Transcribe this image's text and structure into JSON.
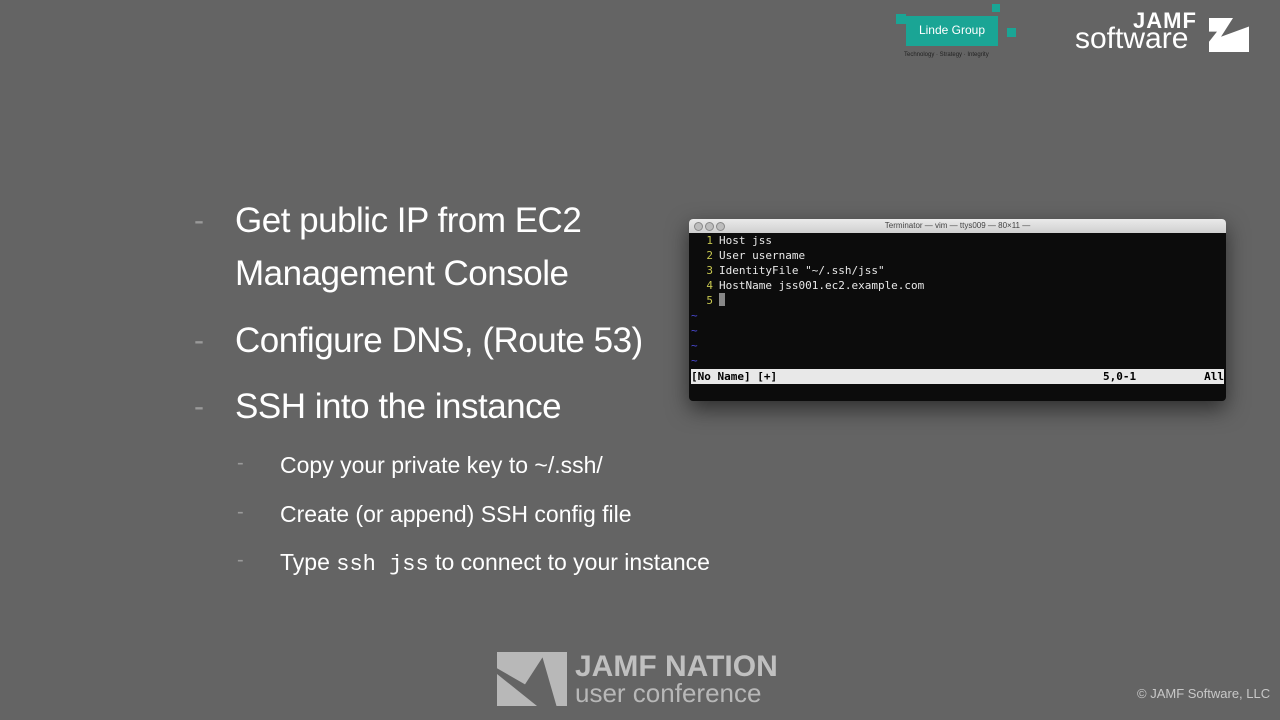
{
  "slide": {
    "bullets": [
      {
        "lines": [
          "Get public IP from EC2",
          "Management Console"
        ]
      },
      {
        "lines": [
          "Configure DNS, (Route 53)"
        ]
      },
      {
        "lines": [
          "SSH into the instance"
        ]
      }
    ],
    "sub_bullets": [
      {
        "text": "Copy your private key to ~/.ssh/"
      },
      {
        "text": "Create (or append) SSH config file"
      },
      {
        "before": "Type ",
        "code": "ssh jss",
        "after": " to connect to your instance"
      }
    ],
    "dash": "-"
  },
  "terminal": {
    "title": "Terminator — vim — ttys009 — 80×11 —",
    "lines": [
      {
        "num": "1",
        "text": "Host jss"
      },
      {
        "num": "2",
        "text": "User username"
      },
      {
        "num": "3",
        "text": "IdentityFile \"~/.ssh/jss\""
      },
      {
        "num": "4",
        "text": "HostName jss001.ec2.example.com"
      },
      {
        "num": "5",
        "text": ""
      }
    ],
    "tilde": "~",
    "status_left": "[No Name] [+]",
    "status_pos": "5,0-1",
    "status_right": "All"
  },
  "logos": {
    "linde_name": "Linde Group",
    "linde_tagline": "Technology · Strategy · Integrity",
    "jamf_top": "JAMF",
    "jamf_bottom": "software",
    "nation_top": "JAMF NATION",
    "nation_bottom": "user conference"
  },
  "footer": {
    "copyright": "© JAMF Software, LLC"
  },
  "colors": {
    "background": "#646464",
    "linde_teal": "#1aa595",
    "line_number": "#c8c850",
    "tilde": "#4b4bd8"
  }
}
